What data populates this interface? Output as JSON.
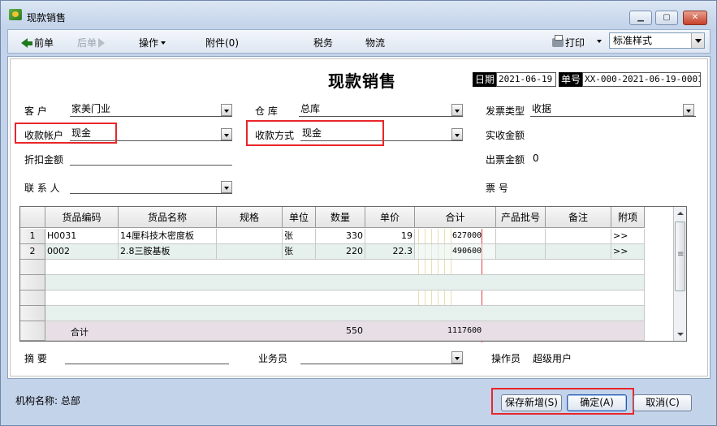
{
  "window": {
    "title": "现款销售"
  },
  "toolbar": {
    "prev": "前单",
    "next": "后单",
    "operate": "操作",
    "attach": "附件(0)",
    "tax": "税务",
    "logistics": "物流",
    "print": "打印",
    "style_select": "标准样式"
  },
  "form": {
    "title": "现款销售",
    "date_label": "日期",
    "date_value": "2021-06-19",
    "no_label": "单号",
    "no_value": "XX-000-2021-06-19-0001",
    "customer_label": "客    户",
    "customer_value": "家美门业",
    "warehouse_label": "仓    库",
    "warehouse_value": "总库",
    "invoice_type_label": "发票类型",
    "invoice_type_value": "收据",
    "account_label": "收款帐户",
    "account_value": "现金",
    "pay_method_label": "收款方式",
    "pay_method_value": "现金",
    "actual_amount_label": "实收金额",
    "discount_label": "折扣金额",
    "invoice_amount_label": "出票金额",
    "invoice_amount_value": "0",
    "contact_label": "联 系 人",
    "ticket_no_label": "票    号",
    "summary_label": "摘    要",
    "salesman_label": "业务员",
    "operator_label": "操作员",
    "operator_value": "超级用户"
  },
  "grid": {
    "columns": [
      "货品编码",
      "货品名称",
      "规格",
      "单位",
      "数量",
      "单价",
      "合计",
      "产品批号",
      "备注",
      "附项"
    ],
    "rows": [
      {
        "idx": "1",
        "code": "H0031",
        "name": "14厘科技木密度板",
        "spec": "",
        "unit": "张",
        "qty": "330",
        "price": "19",
        "total": "627000",
        "batch": "",
        "note": "",
        "extra": ">>"
      },
      {
        "idx": "2",
        "code": "0002",
        "name": "2.8三胺基板",
        "spec": "",
        "unit": "张",
        "qty": "220",
        "price": "22.3",
        "total": "490600",
        "batch": "",
        "note": "",
        "extra": ">>"
      }
    ],
    "total_label": "合计",
    "total_qty": "550",
    "total_amount": "1117600"
  },
  "footer": {
    "org": "机构名称: 总部",
    "save_new": "保存新增(S)",
    "ok": "确定(A)",
    "cancel": "取消(C)"
  }
}
